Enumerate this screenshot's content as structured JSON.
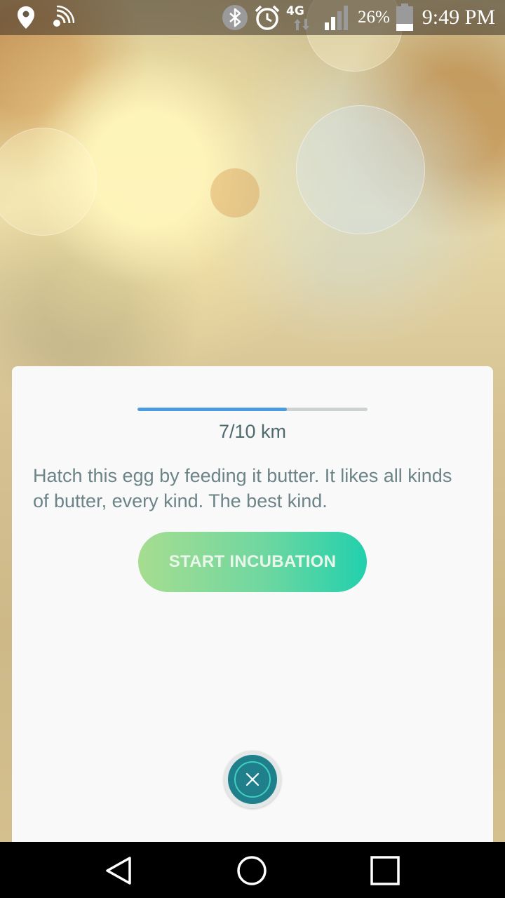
{
  "status_bar": {
    "battery_percent": "26%",
    "time": "9:49 PM",
    "network_label": "4G",
    "icons": [
      "location-pin-icon",
      "nfc-signal-icon",
      "bluetooth-icon",
      "alarm-clock-icon",
      "lte-data-icon",
      "cell-signal-icon",
      "battery-icon"
    ]
  },
  "egg_card": {
    "progress_fraction": 0.65,
    "distance_text": "7/10 km",
    "description": "Hatch this egg by feeding it butter. It likes all kinds of butter, every kind. The best kind.",
    "start_button_label": "START INCUBATION",
    "close_icon": "close-icon"
  },
  "nav_bar": {
    "buttons": [
      "back-icon",
      "home-icon",
      "recents-icon"
    ]
  },
  "colors": {
    "progress_fill": "#4a9be0",
    "progress_track": "#cfd2d3",
    "button_gradient_start": "#a6dd90",
    "button_gradient_end": "#22d0ad",
    "close_button": "#1f7f8a",
    "card_background": "#f9f9f9"
  }
}
